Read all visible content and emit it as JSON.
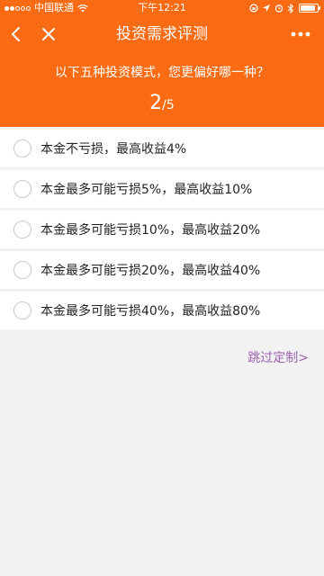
{
  "status_bar": {
    "carrier": "中国联通",
    "time": "下午12:21",
    "battery_level": 0.9
  },
  "nav": {
    "title": "投资需求评测",
    "back_icon": "chevron-left-icon",
    "close_icon": "close-icon",
    "more_icon": "more-dots-icon"
  },
  "question": {
    "text": "以下五种投资模式，您更偏好哪一种？",
    "current": "2",
    "separator": "/",
    "total": "5"
  },
  "options": [
    {
      "label": "本金不亏损，最高收益4%"
    },
    {
      "label": "本金最多可能亏损5%，最高收益10%"
    },
    {
      "label": "本金最多可能亏损10%，最高收益20%"
    },
    {
      "label": "本金最多可能亏损20%，最高收益40%"
    },
    {
      "label": "本金最多可能亏损40%，最高收益80%"
    }
  ],
  "skip": {
    "label": "跳过定制>"
  },
  "colors": {
    "header": "#fb6b13",
    "background": "#f2f2f2",
    "skip_link": "#9c63b0"
  }
}
